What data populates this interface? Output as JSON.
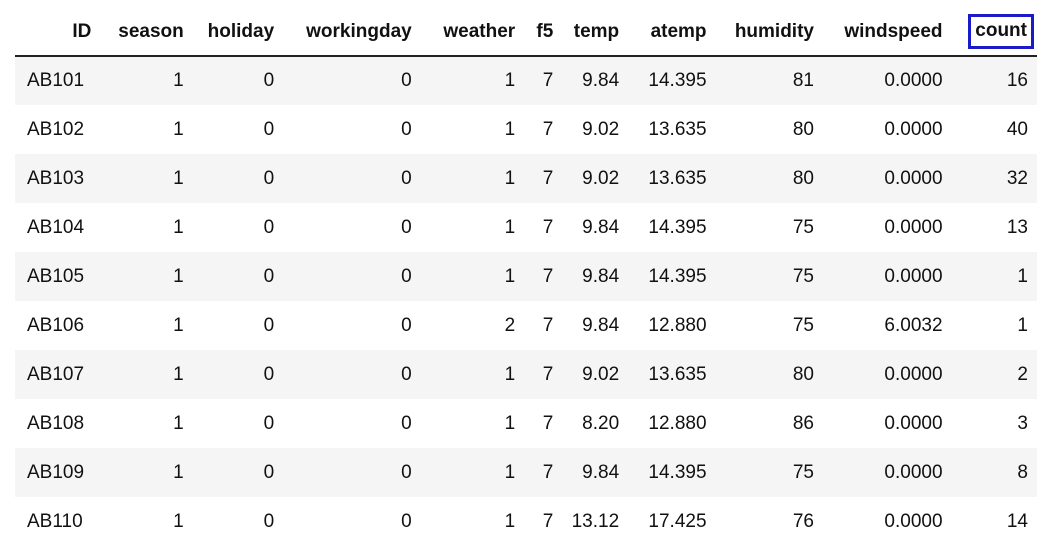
{
  "table": {
    "columns": [
      "ID",
      "season",
      "holiday",
      "workingday",
      "weather",
      "f5",
      "temp",
      "atemp",
      "humidity",
      "windspeed",
      "count"
    ],
    "highlighted_column": "count",
    "highlight_color": "#1a1ac8",
    "rows": [
      [
        "AB101",
        "1",
        "0",
        "0",
        "1",
        "7",
        "9.84",
        "14.395",
        "81",
        "0.0000",
        "16"
      ],
      [
        "AB102",
        "1",
        "0",
        "0",
        "1",
        "7",
        "9.02",
        "13.635",
        "80",
        "0.0000",
        "40"
      ],
      [
        "AB103",
        "1",
        "0",
        "0",
        "1",
        "7",
        "9.02",
        "13.635",
        "80",
        "0.0000",
        "32"
      ],
      [
        "AB104",
        "1",
        "0",
        "0",
        "1",
        "7",
        "9.84",
        "14.395",
        "75",
        "0.0000",
        "13"
      ],
      [
        "AB105",
        "1",
        "0",
        "0",
        "1",
        "7",
        "9.84",
        "14.395",
        "75",
        "0.0000",
        "1"
      ],
      [
        "AB106",
        "1",
        "0",
        "0",
        "2",
        "7",
        "9.84",
        "12.880",
        "75",
        "6.0032",
        "1"
      ],
      [
        "AB107",
        "1",
        "0",
        "0",
        "1",
        "7",
        "9.02",
        "13.635",
        "80",
        "0.0000",
        "2"
      ],
      [
        "AB108",
        "1",
        "0",
        "0",
        "1",
        "7",
        "8.20",
        "12.880",
        "86",
        "0.0000",
        "3"
      ],
      [
        "AB109",
        "1",
        "0",
        "0",
        "1",
        "7",
        "9.84",
        "14.395",
        "75",
        "0.0000",
        "8"
      ],
      [
        "AB110",
        "1",
        "0",
        "0",
        "1",
        "7",
        "13.12",
        "17.425",
        "76",
        "0.0000",
        "14"
      ]
    ]
  }
}
